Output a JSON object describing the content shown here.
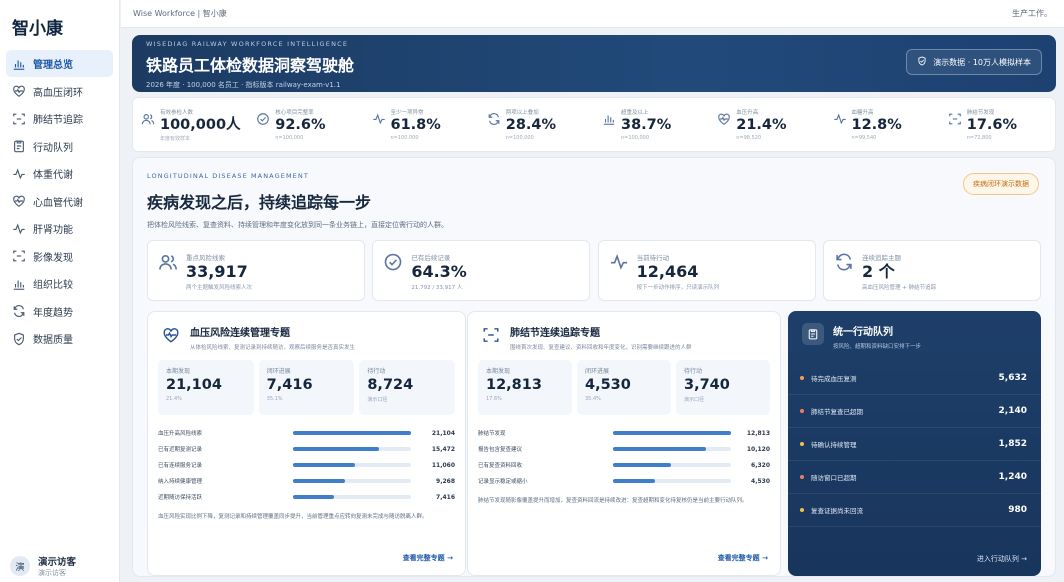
{
  "app": {
    "brand": "智小康"
  },
  "sidebar": {
    "items": [
      {
        "label": "管理总览",
        "icon": "bar-chart-icon",
        "active": true
      },
      {
        "label": "高血压闭环",
        "icon": "heart-pulse-icon"
      },
      {
        "label": "肺结节追踪",
        "icon": "scan-icon"
      },
      {
        "label": "行动队列",
        "icon": "clipboard-icon"
      },
      {
        "label": "体重代谢",
        "icon": "activity-icon"
      },
      {
        "label": "心血管代谢",
        "icon": "heart-pulse-icon"
      },
      {
        "label": "肝肾功能",
        "icon": "activity-icon"
      },
      {
        "label": "影像发现",
        "icon": "scan-icon"
      },
      {
        "label": "组织比较",
        "icon": "bar-chart-icon"
      },
      {
        "label": "年度趋势",
        "icon": "refresh-icon"
      },
      {
        "label": "数据质量",
        "icon": "shield-check-icon"
      }
    ]
  },
  "user": {
    "avatar": "演",
    "name": "演示访客",
    "sub": "演示访客"
  },
  "topbar": {
    "crumb": "Wise Workforce | 智小康",
    "right": "生产工作。"
  },
  "hero": {
    "eyebrow": "WISEDIAG RAILWAY WORKFORCE INTELLIGENCE",
    "title": "铁路员工体检数据洞察驾驶舱",
    "meta": "2026 年度 · 100,000 名员工 · 指标版本 railway-exam-v1.1",
    "pill": "演示数据 · 10万人模拟样本"
  },
  "kpis": [
    {
      "label": "有效参检人数",
      "value": "100,000人",
      "sub": "年度有效样本",
      "icon": "users-icon"
    },
    {
      "label": "核心项目完整率",
      "value": "92.6%",
      "sub": "n=100,000",
      "icon": "check-circle-icon"
    },
    {
      "label": "至少一项异常",
      "value": "61.8%",
      "sub": "n=100,000",
      "icon": "activity-icon"
    },
    {
      "label": "两项以上叠加",
      "value": "28.4%",
      "sub": "n=100,000",
      "icon": "refresh-icon"
    },
    {
      "label": "超重及以上",
      "value": "38.7%",
      "sub": "n=100,000",
      "icon": "bar-chart-icon"
    },
    {
      "label": "血压升高",
      "value": "21.4%",
      "sub": "n=98,520",
      "icon": "heart-pulse-icon"
    },
    {
      "label": "血糖升高",
      "value": "12.8%",
      "sub": "n=99,540",
      "icon": "activity-icon"
    },
    {
      "label": "肺结节发现",
      "value": "17.6%",
      "sub": "n=72,800",
      "icon": "scan-icon"
    }
  ],
  "section": {
    "eyebrow": "LONGITUDINAL DISEASE MANAGEMENT",
    "title": "疾病发现之后，持续追踪每一步",
    "desc": "把体检风险线索、复查资料、持续管理和年度变化放到同一条业务链上，直接定位需行动的人群。",
    "badge": "疾病闭环演示数据",
    "stats": [
      {
        "label": "重点风险线索",
        "value": "33,917",
        "sub": "两个主题触发风险线索人次",
        "icon": "users-icon"
      },
      {
        "label": "已有后续记录",
        "value": "64.3%",
        "sub": "21,792 / 33,917 人",
        "icon": "check-circle-icon"
      },
      {
        "label": "当前待行动",
        "value": "12,464",
        "sub": "按下一步动作排序，只读演示队列",
        "icon": "activity-icon"
      },
      {
        "label": "连续追踪主题",
        "value": "2 个",
        "sub": "高血压风险管理 + 肺结节追踪",
        "icon": "refresh-icon"
      }
    ]
  },
  "bp": {
    "title": "血压风险连续管理专题",
    "sub": "从体检风险线索、复测记录到持续随访，观察后续服务是否真实发生",
    "tiles": [
      {
        "label": "本期发现",
        "value": "21,104",
        "sub": "21.4%"
      },
      {
        "label": "闭环进展",
        "value": "7,416",
        "sub": "35.1%"
      },
      {
        "label": "待行动",
        "value": "8,724",
        "sub": "演示口径"
      }
    ],
    "bars": [
      {
        "label": "血压升高风险线索",
        "value": "21,104",
        "ratio": 1.0
      },
      {
        "label": "已有近期复测记录",
        "value": "15,472",
        "ratio": 0.733
      },
      {
        "label": "已有连续服务记录",
        "value": "11,060",
        "ratio": 0.524
      },
      {
        "label": "纳入持续健康管理",
        "value": "9,268",
        "ratio": 0.439
      },
      {
        "label": "近期随访保持活跃",
        "value": "7,416",
        "ratio": 0.351
      }
    ],
    "note": "血压风险实现比例下降，复测记录和持续管理覆盖同步提升，当前管理重点应转向复测未完成与随访脱离人群。",
    "more": "查看完整专题 →"
  },
  "lung": {
    "title": "肺结节连续追踪专题",
    "sub": "围绕首次发现、复查建议、资料回收和年度变化，识别需要继续跟进的人群",
    "tiles": [
      {
        "label": "本期发现",
        "value": "12,813",
        "sub": "17.6%"
      },
      {
        "label": "闭环进展",
        "value": "4,530",
        "sub": "35.4%"
      },
      {
        "label": "待行动",
        "value": "3,740",
        "sub": "演示口径"
      }
    ],
    "bars": [
      {
        "label": "肺结节发现",
        "value": "12,813",
        "ratio": 1.0
      },
      {
        "label": "报告包含复查建议",
        "value": "10,120",
        "ratio": 0.79
      },
      {
        "label": "已有复查资料回收",
        "value": "6,320",
        "ratio": 0.493
      },
      {
        "label": "记录显示稳定或缩小",
        "value": "4,530",
        "ratio": 0.354
      }
    ],
    "note": "肺结节发现随影像覆盖提升而增加，复查资料回流是持续改进：复查超期和变化待复核仍是当前主要行动队列。",
    "more": "查看完整专题 →"
  },
  "queue": {
    "title": "统一行动队列",
    "sub": "按风险、超期和资料缺口安排下一步",
    "rows": [
      {
        "label": "待完成血压复测",
        "value": "5,632",
        "color": "#f2a04a"
      },
      {
        "label": "肺结节复查已超期",
        "value": "2,140",
        "color": "#f07b5a"
      },
      {
        "label": "待确认持续管理",
        "value": "1,852",
        "color": "#f2c14a"
      },
      {
        "label": "随访窗口已超期",
        "value": "1,240",
        "color": "#f07b5a"
      },
      {
        "label": "复查证据尚未回流",
        "value": "980",
        "color": "#f2c14a"
      }
    ],
    "more": "进入行动队列 →"
  }
}
